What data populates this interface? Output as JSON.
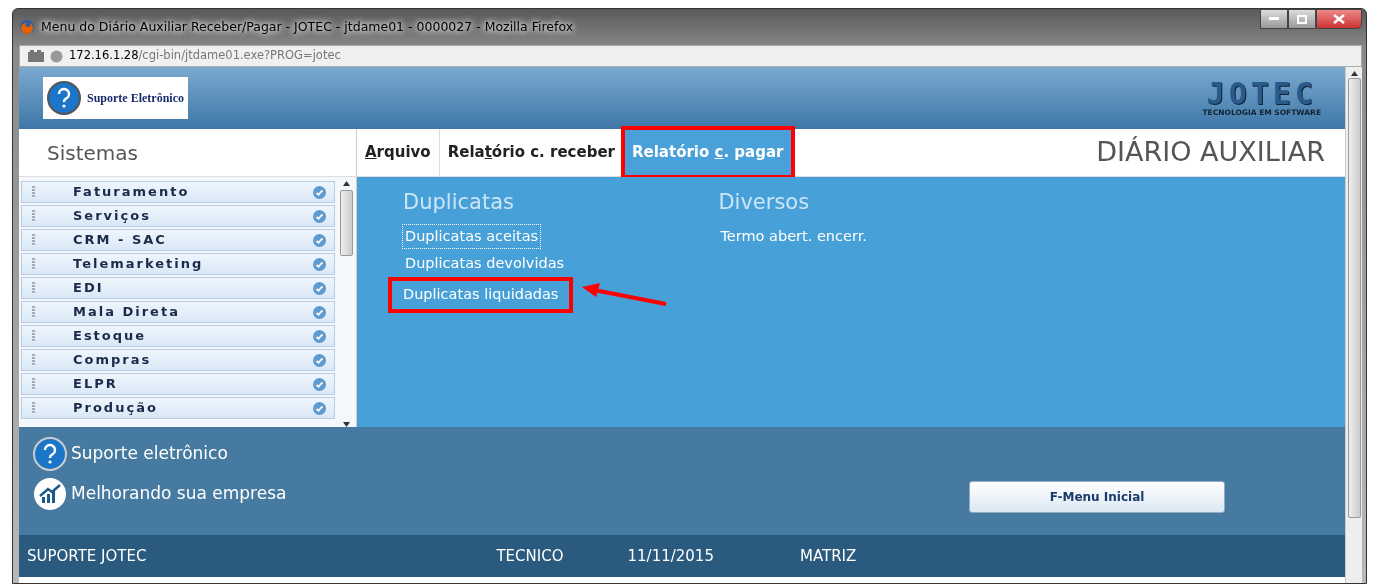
{
  "window": {
    "title": "Menu do Diário Auxiliar Receber/Pagar - JOTEC - jtdame01 - 0000027 - Mozilla Firefox"
  },
  "address": {
    "host": "172.16.1.28",
    "path": "/cgi-bin/jtdame01.exe?PROG=jotec"
  },
  "header": {
    "support_label": "Suporte Eletrônico",
    "logo": "JOTEC",
    "logo_tagline": "TECNOLOGIA EM SOFTWARE"
  },
  "sidebar": {
    "title": "Sistemas",
    "items": [
      {
        "label": "Faturamento"
      },
      {
        "label": "Serviços"
      },
      {
        "label": "CRM - SAC"
      },
      {
        "label": "Telemarketing"
      },
      {
        "label": "EDI"
      },
      {
        "label": "Mala Direta"
      },
      {
        "label": "Estoque"
      },
      {
        "label": "Compras"
      },
      {
        "label": "ELPR"
      },
      {
        "label": "Produção"
      }
    ]
  },
  "menu": [
    {
      "key": "A",
      "after": "rquivo",
      "selected": false,
      "highlighted": false
    },
    {
      "before": "Rela",
      "key": "t",
      "after": "ório c. receber",
      "selected": false,
      "highlighted": false
    },
    {
      "before": "Relatório ",
      "key": "c",
      "after": ". pagar",
      "selected": true,
      "highlighted": true
    }
  ],
  "page_title": "DIÁRIO AUXILIAR",
  "columns": [
    {
      "heading": "Duplicatas",
      "links": [
        {
          "label": "Duplicatas aceitas",
          "focused": true,
          "highlighted": false
        },
        {
          "label": "Duplicatas devolvidas",
          "focused": false,
          "highlighted": false
        },
        {
          "label": "Duplicatas liquidadas",
          "focused": false,
          "highlighted": true
        }
      ]
    },
    {
      "heading": "Diversos",
      "links": [
        {
          "label": "Termo abert. encerr.",
          "focused": false,
          "highlighted": false
        }
      ]
    }
  ],
  "footer": {
    "links": [
      {
        "kind": "support",
        "label": "Suporte eletrônico"
      },
      {
        "kind": "growth",
        "label": "Melhorando sua empresa"
      }
    ],
    "button": "F-Menu Inicial"
  },
  "status_bar": [
    "SUPORTE JOTEC",
    "TECNICO",
    "11/11/2015",
    "MATRIZ"
  ]
}
